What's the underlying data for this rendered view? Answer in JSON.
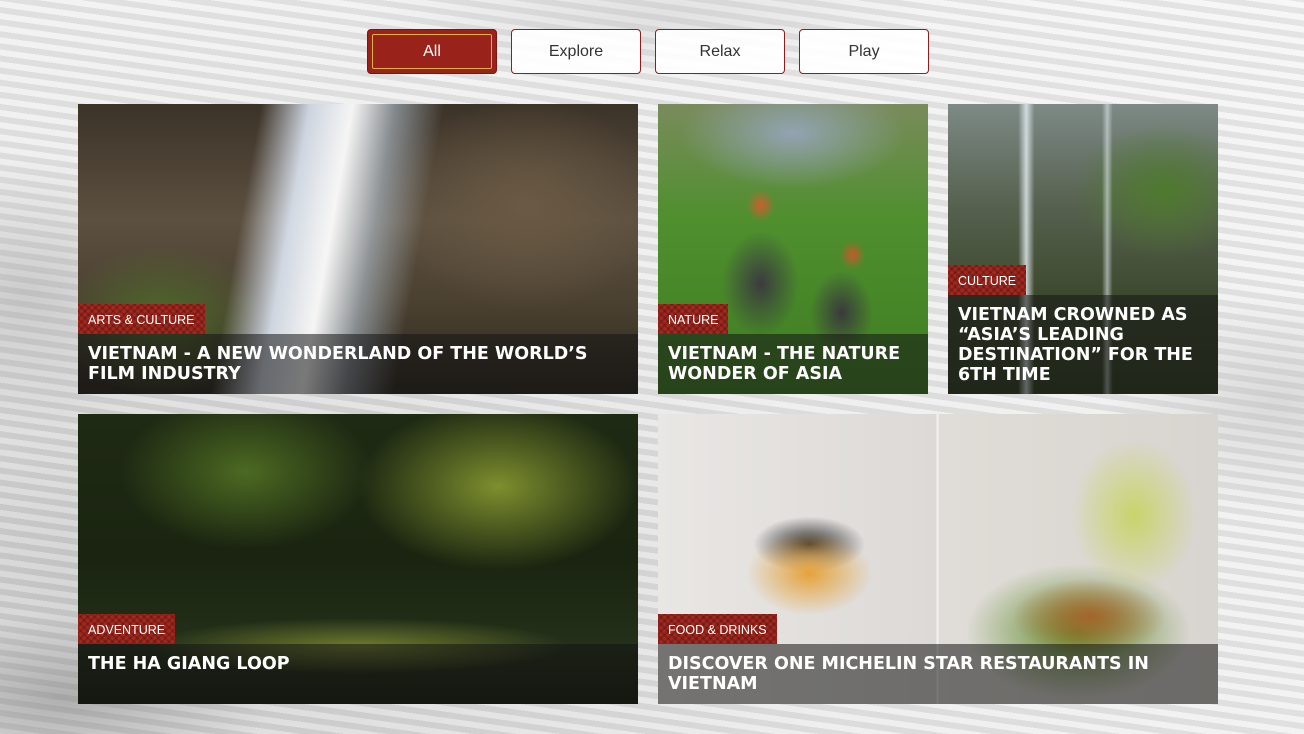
{
  "filters": [
    {
      "label": "All",
      "active": true
    },
    {
      "label": "Explore",
      "active": false
    },
    {
      "label": "Relax",
      "active": false
    },
    {
      "label": "Play",
      "active": false
    }
  ],
  "cards": [
    {
      "tag": "ARTS & CULTURE",
      "title": "VIETNAM - A NEW WONDERLAND OF THE WORLD’S FILM INDUSTRY",
      "image": "cave-light-beam"
    },
    {
      "tag": "NATURE",
      "title": "VIETNAM - THE NATURE WONDER OF ASIA",
      "image": "langur-monkeys"
    },
    {
      "tag": "CULTURE",
      "title": "VIETNAM CROWNED AS “ASIA’S LEADING DESTINATION” FOR THE 6TH TIME",
      "image": "waterfall"
    },
    {
      "tag": "ADVENTURE",
      "title": "THE HA GIANG LOOP",
      "image": "forest-path"
    },
    {
      "tag": "FOOD & DRINKS",
      "title": "DISCOVER ONE MICHELIN STAR RESTAURANTS IN VIETNAM",
      "image": "michelin-dishes"
    }
  ],
  "colors": {
    "accent": "#99221b",
    "tag": "#a3281f",
    "gold": "#e0b04c"
  }
}
